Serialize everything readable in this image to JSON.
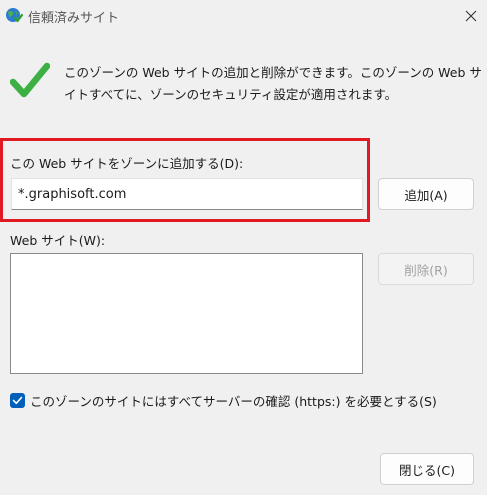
{
  "window": {
    "title": "信頼済みサイト",
    "title_icon": "globe-check-icon",
    "close_icon": "close-icon"
  },
  "info": {
    "icon": "checkmark-icon",
    "text": "このゾーンの Web サイトの追加と削除ができます。このゾーンの Web サイトすべてに、ゾーンのセキュリティ設定が適用されます。"
  },
  "add_site": {
    "label": "この Web サイトをゾーンに追加する(D):",
    "value": "*.graphisoft.com",
    "add_button": "追加(A)"
  },
  "sites": {
    "label": "Web サイト(W):",
    "items": [],
    "remove_button": "削除(R)"
  },
  "https": {
    "checked": true,
    "label": "このゾーンのサイトにはすべてサーバーの確認 (https:) を必要とする(S)"
  },
  "footer": {
    "close_button": "閉じる(C)"
  },
  "colors": {
    "highlight": "#e01a22",
    "accent": "#005fb8",
    "check": "#3cb043"
  }
}
